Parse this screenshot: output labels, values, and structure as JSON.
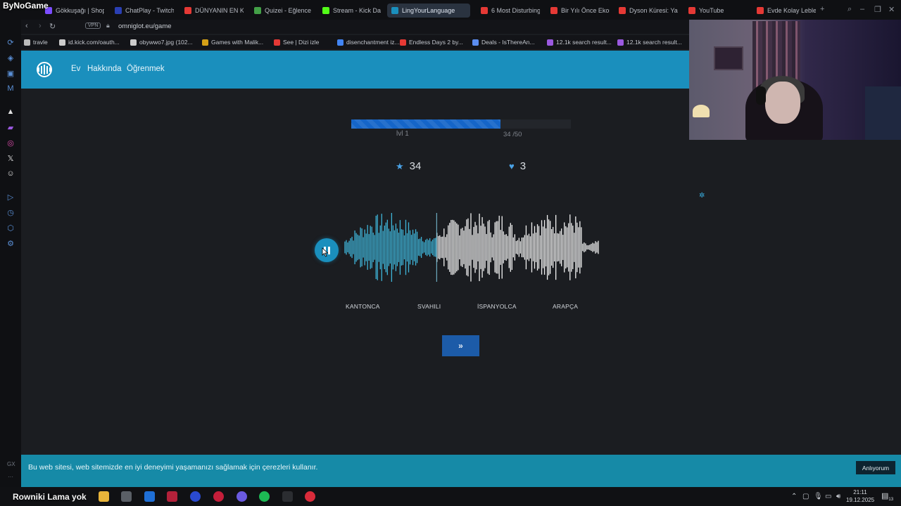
{
  "overlay": {
    "brand": "ByNoGame",
    "taskbar_brand": "Rowniki Lama yok"
  },
  "tabs": [
    {
      "label": "Gökkuşağı | Shop",
      "color": "#7c4dff"
    },
    {
      "label": "ChatPlay - Twitch",
      "color": "#2a3fb3"
    },
    {
      "label": "DÜNYANIN EN K",
      "color": "#e53935"
    },
    {
      "label": "Quizei - Eğlence",
      "color": "#43a047"
    },
    {
      "label": "Stream - Kick Da",
      "color": "#53fc18"
    },
    {
      "label": "LingYourLanguage",
      "color": "#1a8fbd"
    },
    {
      "label": "6 Most Disturbing",
      "color": "#e53935"
    },
    {
      "label": "Bir Yılı Önce Ekos",
      "color": "#e53935"
    },
    {
      "label": "Dyson Küresi: Ya",
      "color": "#e53935"
    },
    {
      "label": "YouTube",
      "color": "#e53935"
    },
    {
      "label": "Evde Kolay Leble",
      "color": "#e53935"
    }
  ],
  "address": {
    "vpn": "VPN",
    "url": "omniglot.eu/game"
  },
  "bookmarks": [
    {
      "label": "travle",
      "color": "#bbbbbb"
    },
    {
      "label": "id.kick.com/oauth...",
      "color": "#cccccc"
    },
    {
      "label": "obywwo7.jpg (102...",
      "color": "#cccccc"
    },
    {
      "label": "Games with Malik...",
      "color": "#d4a017"
    },
    {
      "label": "See | Dizi izle",
      "color": "#e53935"
    },
    {
      "label": "disenchantment iz...",
      "color": "#4285f4"
    },
    {
      "label": "Endless Days 2 by...",
      "color": "#e53935"
    },
    {
      "label": "Deals - IsThereAn...",
      "color": "#5b8def"
    },
    {
      "label": "12.1k search result...",
      "color": "#9b59e0"
    },
    {
      "label": "12.1k search result...",
      "color": "#9b59e0"
    }
  ],
  "site": {
    "nav": [
      "Ev",
      "Hakkında",
      "Öğrenmek"
    ]
  },
  "game": {
    "level": "lvl 1",
    "progress_text": "34 /50",
    "progress_fraction": 0.68,
    "score": "34",
    "lives": "3",
    "playback_fraction": 0.36,
    "choices": [
      "KANTONCA",
      "SVAHILI",
      "İSPANYOLCA",
      "ARAPÇA"
    ],
    "next_label": "»"
  },
  "cookie": {
    "text": "Bu web sitesi, web sitemizde en iyi deneyimi yaşamanızı sağlamak için çerezleri kullanır.",
    "accept": "Anlıyorum"
  },
  "taskbar": {
    "time": "21:11",
    "date": "19.12.2025",
    "notifications": "13"
  },
  "colors": {
    "header": "#1a8fbd",
    "progress": "#1565c8",
    "wave_played": "#3fb4d8",
    "wave_unplayed": "#f2f2f2",
    "next_button": "#1c5ba8",
    "cookie_bar": "#168aa7"
  }
}
